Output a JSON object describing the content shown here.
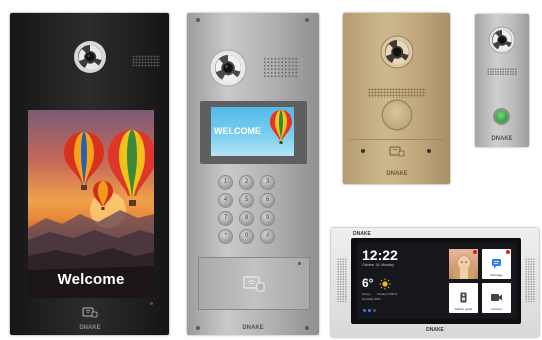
{
  "panel_full_screen": {
    "welcome_text": "Welcome",
    "brand": "DNAKE",
    "icons": [
      "camera-icon",
      "speaker-grille-icon",
      "hot-air-balloon-icon",
      "card-reader-icon"
    ]
  },
  "panel_keypad": {
    "welcome_text": "WELCOME",
    "brand": "DNAKE",
    "keys": [
      "1",
      "2",
      "3",
      "4",
      "5",
      "6",
      "7",
      "8",
      "9",
      "*",
      "0",
      "#",
      "",
      "",
      ""
    ],
    "icons": [
      "camera-icon",
      "speaker-grille-icon",
      "card-reader-icon",
      "keypad-icon"
    ]
  },
  "panel_gold": {
    "brand": "DNAKE",
    "icons": [
      "camera-icon",
      "speaker-grille-icon",
      "call-button-icon",
      "card-reader-icon"
    ]
  },
  "panel_small": {
    "brand": "DNAKE",
    "icons": [
      "camera-icon",
      "speaker-grille-icon",
      "call-button-icon"
    ]
  },
  "indoor_monitor": {
    "brand": "DNAKE",
    "time": "12:22",
    "date": "October 15, Monday",
    "temperature": "6°",
    "weather_lines": [
      "Sunny",
      "Outdoor PM2.5",
      "Humidity 68%"
    ],
    "tiles": [
      {
        "label": "",
        "icon": "avatar-icon"
      },
      {
        "label": "Message",
        "icon": "message-icon"
      },
      {
        "label": "Station guide",
        "icon": "station-icon"
      },
      {
        "label": "Camera",
        "icon": "camera-icon"
      }
    ],
    "icons": [
      "sun-icon",
      "weather-icon"
    ]
  },
  "colors": {
    "black_panel": "#222222",
    "stainless": "#b5b5b5",
    "gold": "#c0a87c",
    "silver": "#c4c4c4",
    "monitor_frame": "#e5e5e5",
    "call_button_green": "#3aa84a"
  }
}
